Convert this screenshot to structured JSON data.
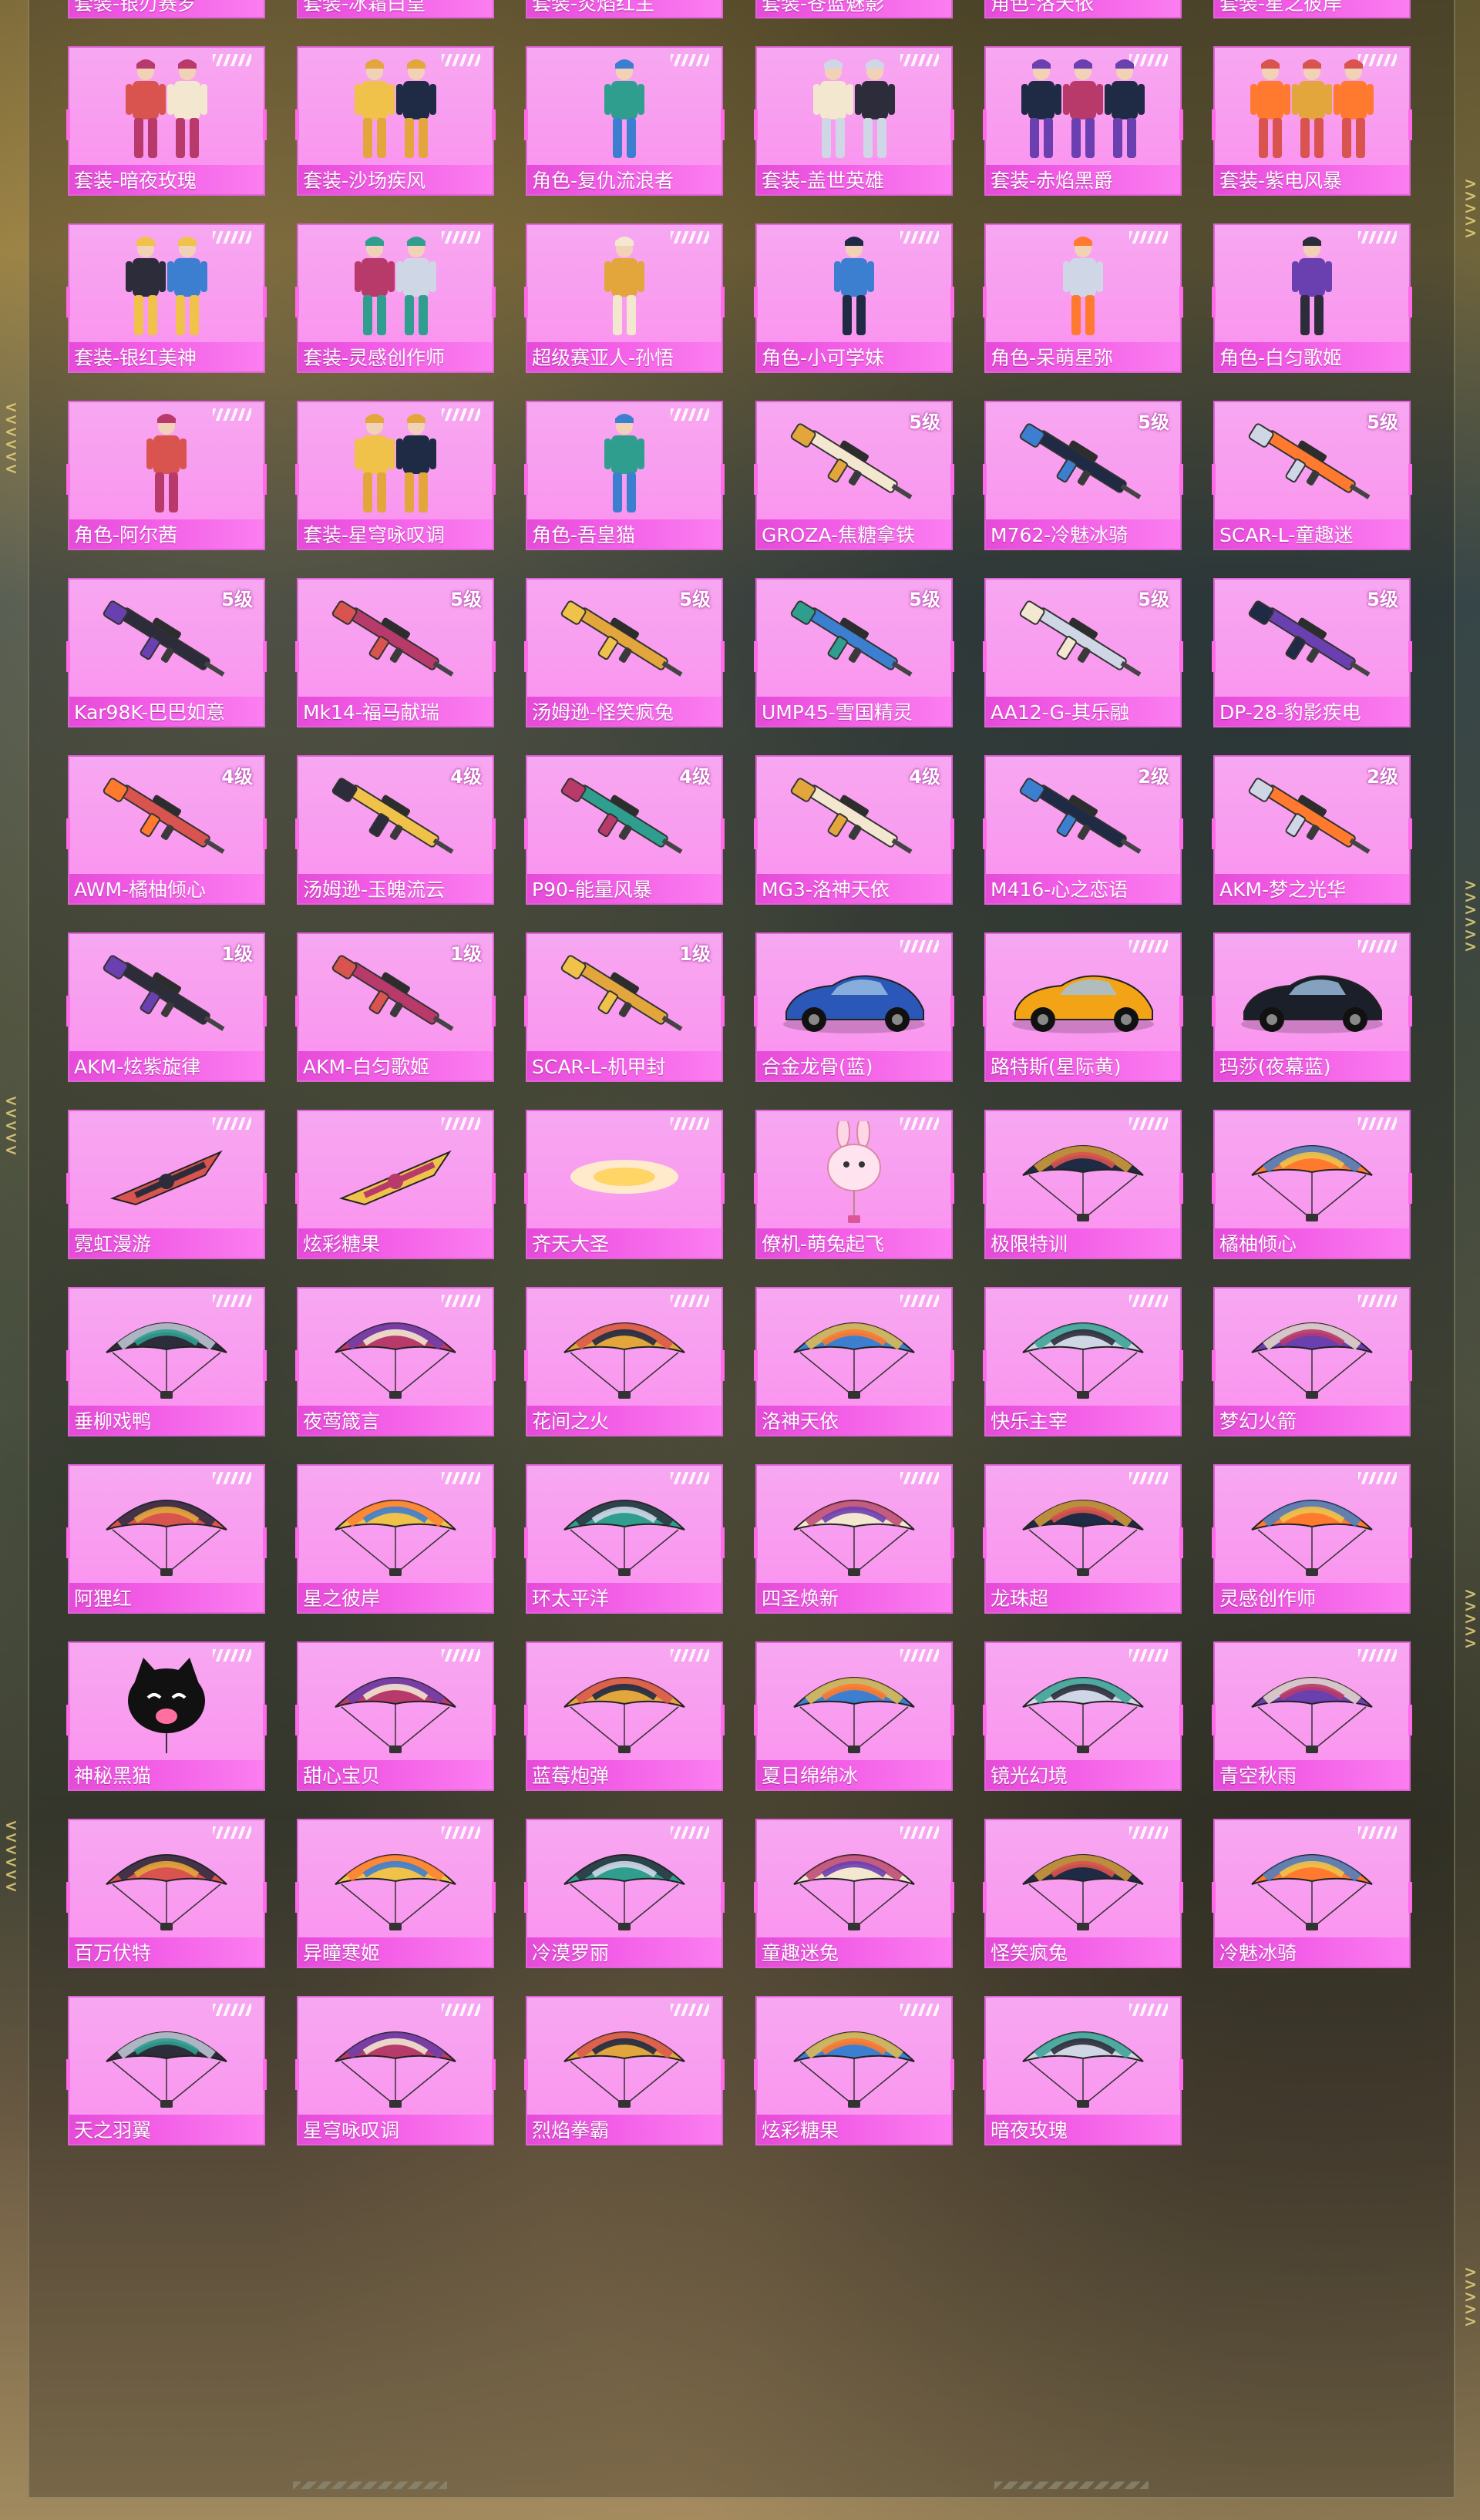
{
  "items": [
    {
      "name": "套装-银刃赛罗",
      "kind": "suit",
      "grade": "",
      "icon": "suit-icon"
    },
    {
      "name": "套装-冰霜白皇",
      "kind": "suit",
      "grade": "",
      "icon": "suit-icon"
    },
    {
      "name": "套装-炎焰红主",
      "kind": "suit",
      "grade": "",
      "icon": "suit-icon"
    },
    {
      "name": "套装-苍蓝魅影",
      "kind": "suit",
      "grade": "",
      "icon": "suit-icon"
    },
    {
      "name": "角色-洛天依",
      "kind": "character",
      "grade": "",
      "icon": "character-icon"
    },
    {
      "name": "套装-星之彼岸",
      "kind": "suit",
      "grade": "",
      "icon": "suit-icon"
    },
    {
      "name": "套装-暗夜玫瑰",
      "kind": "suit",
      "grade": "",
      "icon": "suit-icon"
    },
    {
      "name": "套装-沙场疾风",
      "kind": "suit",
      "grade": "",
      "icon": "suit-icon"
    },
    {
      "name": "角色-复仇流浪者",
      "kind": "character",
      "grade": "",
      "icon": "character-icon"
    },
    {
      "name": "套装-盖世英雄",
      "kind": "suit",
      "grade": "",
      "icon": "suit-icon"
    },
    {
      "name": "套装-赤焰黑爵",
      "kind": "suit",
      "grade": "",
      "icon": "suit-icon"
    },
    {
      "name": "套装-紫电风暴",
      "kind": "suit",
      "grade": "",
      "icon": "suit-icon"
    },
    {
      "name": "套装-银红美神",
      "kind": "suit",
      "grade": "",
      "icon": "suit-icon"
    },
    {
      "name": "套装-灵感创作师",
      "kind": "suit",
      "grade": "",
      "icon": "suit-icon"
    },
    {
      "name": "超级赛亚人-孙悟",
      "kind": "character",
      "grade": "",
      "icon": "character-icon"
    },
    {
      "name": "角色-小可学妹",
      "kind": "character",
      "grade": "",
      "icon": "character-icon"
    },
    {
      "name": "角色-呆萌星弥",
      "kind": "character",
      "grade": "",
      "icon": "character-icon"
    },
    {
      "name": "角色-白匀歌姬",
      "kind": "character",
      "grade": "",
      "icon": "character-icon"
    },
    {
      "name": "角色-阿尔茜",
      "kind": "character",
      "grade": "",
      "icon": "character-icon"
    },
    {
      "name": "套装-星穹咏叹调",
      "kind": "suit",
      "grade": "",
      "icon": "suit-icon"
    },
    {
      "name": "角色-吾皇猫",
      "kind": "character",
      "grade": "",
      "icon": "character-icon"
    },
    {
      "name": "GROZA-焦糖拿铁",
      "kind": "gun",
      "grade": "5级",
      "icon": "rifle-icon"
    },
    {
      "name": "M762-冷魅冰骑",
      "kind": "gun",
      "grade": "5级",
      "icon": "rifle-icon"
    },
    {
      "name": "SCAR-L-童趣迷",
      "kind": "gun",
      "grade": "5级",
      "icon": "rifle-icon"
    },
    {
      "name": "Kar98K-巴巴如意",
      "kind": "gun",
      "grade": "5级",
      "icon": "sniper-icon"
    },
    {
      "name": "Mk14-福马献瑞",
      "kind": "gun",
      "grade": "5级",
      "icon": "rifle-icon"
    },
    {
      "name": "汤姆逊-怪笑疯兔",
      "kind": "gun",
      "grade": "5级",
      "icon": "smg-icon"
    },
    {
      "name": "UMP45-雪国精灵",
      "kind": "gun",
      "grade": "5级",
      "icon": "smg-icon"
    },
    {
      "name": "AA12-G-其乐融",
      "kind": "gun",
      "grade": "5级",
      "icon": "shotgun-icon"
    },
    {
      "name": "DP-28-豹影疾电",
      "kind": "gun",
      "grade": "5级",
      "icon": "lmg-icon"
    },
    {
      "name": "AWM-橘柚倾心",
      "kind": "gun",
      "grade": "4级",
      "icon": "sniper-icon"
    },
    {
      "name": "汤姆逊-玉魄流云",
      "kind": "gun",
      "grade": "4级",
      "icon": "smg-icon"
    },
    {
      "name": "P90-能量风暴",
      "kind": "gun",
      "grade": "4级",
      "icon": "smg-icon"
    },
    {
      "name": "MG3-洛神天依",
      "kind": "gun",
      "grade": "4级",
      "icon": "lmg-icon"
    },
    {
      "name": "M416-心之恋语",
      "kind": "gun",
      "grade": "2级",
      "icon": "rifle-icon"
    },
    {
      "name": "AKM-梦之光华",
      "kind": "gun",
      "grade": "2级",
      "icon": "rifle-icon"
    },
    {
      "name": "AKM-炫紫旋律",
      "kind": "gun",
      "grade": "1级",
      "icon": "rifle-icon"
    },
    {
      "name": "AKM-白匀歌姬",
      "kind": "gun",
      "grade": "1级",
      "icon": "rifle-icon"
    },
    {
      "name": "SCAR-L-机甲封",
      "kind": "gun",
      "grade": "1级",
      "icon": "rifle-icon"
    },
    {
      "name": "合金龙骨(蓝)",
      "kind": "car",
      "grade": "",
      "icon": "buggy-icon"
    },
    {
      "name": "路特斯(星际黄)",
      "kind": "car",
      "grade": "",
      "icon": "sports-car-icon"
    },
    {
      "name": "玛莎(夜幕蓝)",
      "kind": "car",
      "grade": "",
      "icon": "sedan-icon"
    },
    {
      "name": "霓虹漫游",
      "kind": "glider",
      "grade": "",
      "icon": "glider-icon"
    },
    {
      "name": "炫彩糖果",
      "kind": "glider",
      "grade": "",
      "icon": "glider-icon"
    },
    {
      "name": "齐天大圣",
      "kind": "glider",
      "grade": "",
      "icon": "cloud-icon"
    },
    {
      "name": "僚机-萌兔起飞",
      "kind": "glider",
      "grade": "",
      "icon": "bunny-icon"
    },
    {
      "name": "极限特训",
      "kind": "parachute",
      "grade": "",
      "icon": "parachute-icon"
    },
    {
      "name": "橘柚倾心",
      "kind": "parachute",
      "grade": "",
      "icon": "parachute-icon"
    },
    {
      "name": "垂柳戏鸭",
      "kind": "parachute",
      "grade": "",
      "icon": "parachute-icon"
    },
    {
      "name": "夜莺箴言",
      "kind": "parachute",
      "grade": "",
      "icon": "parachute-icon"
    },
    {
      "name": "花间之火",
      "kind": "parachute",
      "grade": "",
      "icon": "parachute-icon"
    },
    {
      "name": "洛神天依",
      "kind": "parachute",
      "grade": "",
      "icon": "parachute-icon"
    },
    {
      "name": "快乐主宰",
      "kind": "parachute",
      "grade": "",
      "icon": "parachute-icon"
    },
    {
      "name": "梦幻火箭",
      "kind": "parachute",
      "grade": "",
      "icon": "parachute-icon"
    },
    {
      "name": "阿狸红",
      "kind": "parachute",
      "grade": "",
      "icon": "parachute-icon"
    },
    {
      "name": "星之彼岸",
      "kind": "parachute",
      "grade": "",
      "icon": "parachute-icon"
    },
    {
      "name": "环太平洋",
      "kind": "parachute",
      "grade": "",
      "icon": "parachute-icon"
    },
    {
      "name": "四圣焕新",
      "kind": "parachute",
      "grade": "",
      "icon": "parachute-icon"
    },
    {
      "name": "龙珠超",
      "kind": "parachute",
      "grade": "",
      "icon": "parachute-icon"
    },
    {
      "name": "灵感创作师",
      "kind": "parachute",
      "grade": "",
      "icon": "parachute-icon"
    },
    {
      "name": "神秘黑猫",
      "kind": "parachute",
      "grade": "",
      "icon": "cat-balloon-icon"
    },
    {
      "name": "甜心宝贝",
      "kind": "parachute",
      "grade": "",
      "icon": "parachute-icon"
    },
    {
      "name": "蓝莓炮弹",
      "kind": "parachute",
      "grade": "",
      "icon": "parachute-icon"
    },
    {
      "name": "夏日绵绵冰",
      "kind": "parachute",
      "grade": "",
      "icon": "parachute-icon"
    },
    {
      "name": "镜光幻境",
      "kind": "parachute",
      "grade": "",
      "icon": "parachute-icon"
    },
    {
      "name": "青空秋雨",
      "kind": "parachute",
      "grade": "",
      "icon": "parachute-icon"
    },
    {
      "name": "百万伏特",
      "kind": "parachute",
      "grade": "",
      "icon": "parachute-icon"
    },
    {
      "name": "异瞳寒姬",
      "kind": "parachute",
      "grade": "",
      "icon": "parachute-icon"
    },
    {
      "name": "冷漠罗丽",
      "kind": "parachute",
      "grade": "",
      "icon": "parachute-icon"
    },
    {
      "name": "童趣迷兔",
      "kind": "parachute",
      "grade": "",
      "icon": "parachute-icon"
    },
    {
      "name": "怪笑疯兔",
      "kind": "parachute",
      "grade": "",
      "icon": "parachute-icon"
    },
    {
      "name": "冷魅冰骑",
      "kind": "parachute",
      "grade": "",
      "icon": "parachute-icon"
    },
    {
      "name": "天之羽翼",
      "kind": "parachute",
      "grade": "",
      "icon": "parachute-icon"
    },
    {
      "name": "星穹咏叹调",
      "kind": "parachute",
      "grade": "",
      "icon": "parachute-icon"
    },
    {
      "name": "烈焰拳霸",
      "kind": "parachute",
      "grade": "",
      "icon": "parachute-icon"
    },
    {
      "name": "炫彩糖果",
      "kind": "parachute",
      "grade": "",
      "icon": "parachute-icon"
    },
    {
      "name": "暗夜玫瑰",
      "kind": "parachute",
      "grade": "",
      "icon": "parachute-icon"
    }
  ],
  "colors": {
    "card_bg": "#f99bef",
    "name_bar": "#e54bd8",
    "card_border": "#e163d8",
    "chevron": "#e6d27a",
    "palette": [
      "#2c2c3a",
      "#b83a6a",
      "#e2a63c",
      "#3c7fd0",
      "#cfd7e6",
      "#6a3fb0",
      "#d9534f",
      "#f0c24a",
      "#2f9e8f",
      "#f3e7d0",
      "#1f2a44",
      "#ff7a2f"
    ]
  }
}
